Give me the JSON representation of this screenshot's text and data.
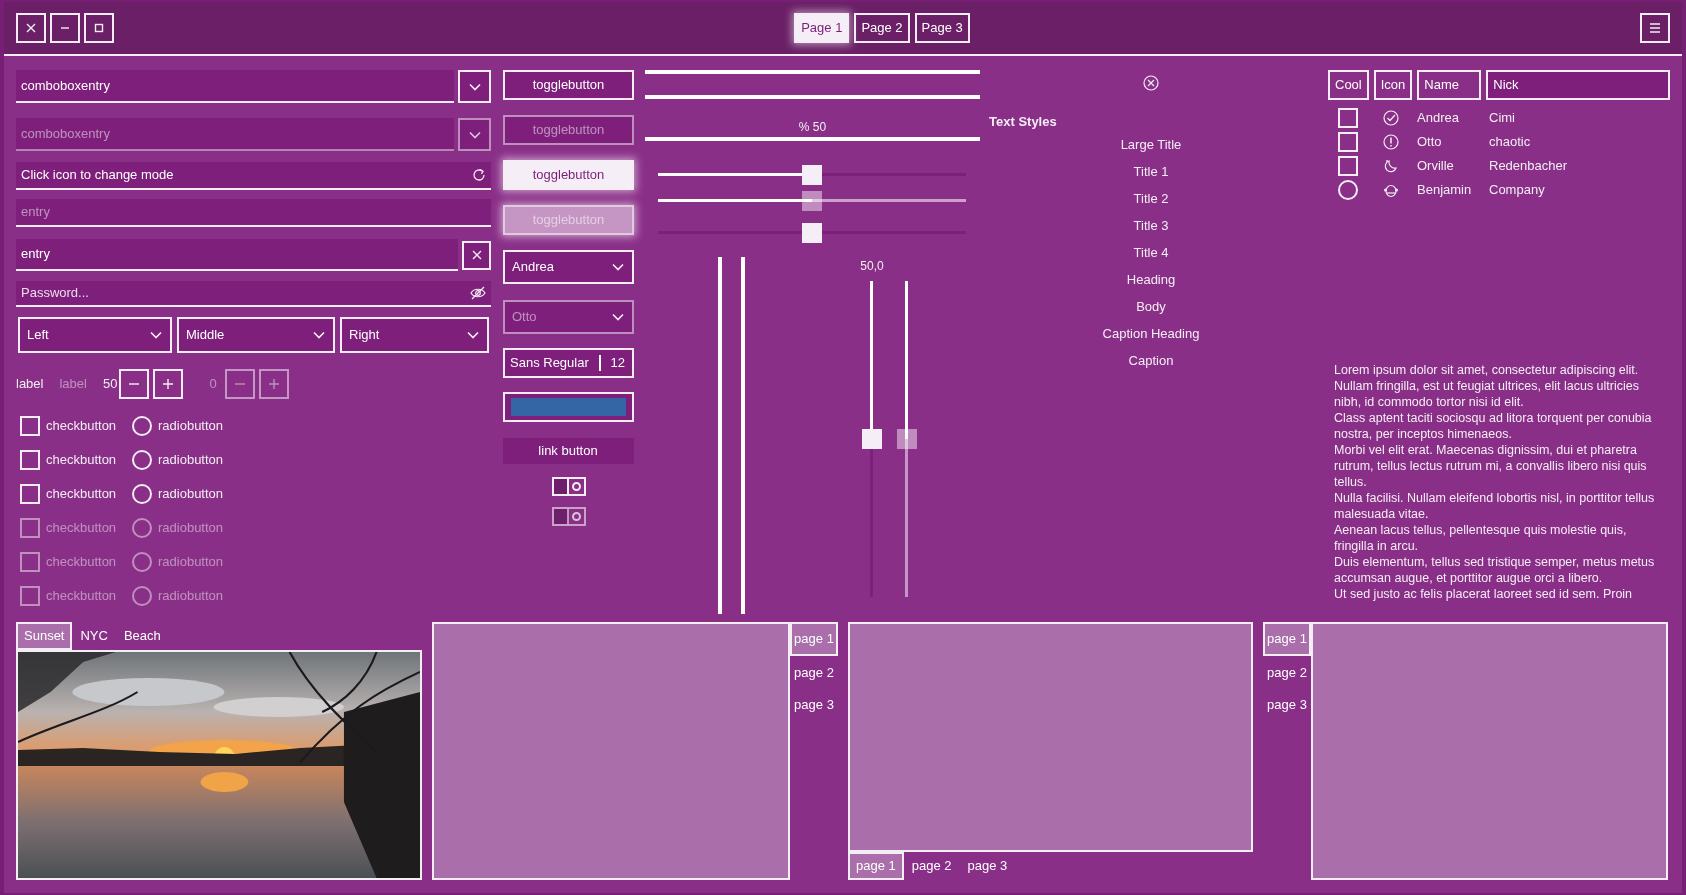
{
  "header": {
    "tabs": [
      {
        "label": "Page 1",
        "selected": true
      },
      {
        "label": "Page 2",
        "selected": false
      },
      {
        "label": "Page 3",
        "selected": false
      }
    ]
  },
  "entries": [
    {
      "kind": "combo",
      "value": "comboboxentry",
      "disabled": false
    },
    {
      "kind": "combo",
      "value": "comboboxentry",
      "disabled": true
    },
    {
      "kind": "icon",
      "value": "Click icon to change mode",
      "disabled": false
    },
    {
      "kind": "plain",
      "placeholder": "entry",
      "disabled": false
    },
    {
      "kind": "clear",
      "value": "entry",
      "disabled": false
    },
    {
      "kind": "password",
      "placeholder": "Password...",
      "disabled": false
    }
  ],
  "combos": [
    {
      "value": "Left"
    },
    {
      "value": "Middle"
    },
    {
      "value": "Right"
    }
  ],
  "labels": [
    {
      "text": "label",
      "disabled": false
    },
    {
      "text": "label",
      "disabled": true
    }
  ],
  "spins": [
    {
      "value": "50",
      "disabled": false
    },
    {
      "value": "0",
      "disabled": true
    }
  ],
  "checks": [
    {
      "label": "checkbutton",
      "checked": false,
      "disabled": false
    },
    {
      "label": "checkbutton",
      "checked": false,
      "disabled": false
    },
    {
      "label": "checkbutton",
      "checked": false,
      "disabled": false
    },
    {
      "label": "checkbutton",
      "checked": false,
      "disabled": true
    },
    {
      "label": "checkbutton",
      "checked": false,
      "disabled": true
    },
    {
      "label": "checkbutton",
      "checked": false,
      "disabled": true
    }
  ],
  "radios": [
    {
      "label": "radiobutton",
      "checked": false,
      "disabled": false
    },
    {
      "label": "radiobutton",
      "checked": false,
      "disabled": false
    },
    {
      "label": "radiobutton",
      "checked": false,
      "disabled": false
    },
    {
      "label": "radiobutton",
      "checked": false,
      "disabled": true
    },
    {
      "label": "radiobutton",
      "checked": false,
      "disabled": true
    },
    {
      "label": "radiobutton",
      "checked": false,
      "disabled": true
    }
  ],
  "toggle_buttons": [
    {
      "label": "togglebutton",
      "selected": false,
      "disabled": false
    },
    {
      "label": "togglebutton",
      "selected": false,
      "disabled": true
    },
    {
      "label": "togglebutton",
      "selected": true,
      "disabled": false
    },
    {
      "label": "togglebutton",
      "selected": true,
      "disabled": true
    }
  ],
  "dropdowns": [
    {
      "value": "Andrea",
      "disabled": false
    },
    {
      "value": "Otto",
      "disabled": true
    }
  ],
  "font_button": {
    "family": "Sans Regular",
    "size": "12"
  },
  "color_button": {
    "color": "#3465a4"
  },
  "link_button": {
    "label": "link button"
  },
  "switches": [
    {
      "on": false,
      "disabled": false
    },
    {
      "on": false,
      "disabled": true
    }
  ],
  "progress_bars": [
    {
      "level": 1
    },
    {
      "level": 1
    },
    {
      "level": 1,
      "text": "% 50"
    }
  ],
  "scales": [
    {
      "kind": "highlight",
      "level": 0.5,
      "disabled": false
    },
    {
      "kind": "highlight",
      "level": 0.5,
      "disabled": true
    },
    {
      "kind": "plain",
      "level": 0.5,
      "disabled": false
    }
  ],
  "vertical_bars": [
    {
      "level": 1
    },
    {
      "level": 1
    }
  ],
  "vscales": {
    "reading": "50,0",
    "items": [
      {
        "level": 0.5,
        "disabled": false
      },
      {
        "level": 0.5,
        "disabled": true
      }
    ]
  },
  "text_styles": {
    "title": "Text Styles",
    "items": [
      "Large Title",
      "Title 1",
      "Title 2",
      "Title 3",
      "Title 4",
      "Heading",
      "Body",
      "Caption Heading",
      "Caption"
    ]
  },
  "tree": {
    "columns": [
      "Cool",
      "Icon",
      "Name",
      "Nick"
    ],
    "rows": [
      {
        "kind": "check",
        "checked": false,
        "name": "Andrea",
        "nick": "Cimi"
      },
      {
        "kind": "check",
        "checked": false,
        "name": "Otto",
        "nick": "chaotic"
      },
      {
        "kind": "check",
        "checked": false,
        "name": "Orville",
        "nick": "Redenbacher"
      },
      {
        "kind": "radio",
        "checked": false,
        "name": "Benjamin",
        "nick": "Company"
      }
    ]
  },
  "lorem": [
    "Lorem ipsum dolor sit amet, consectetur adipiscing elit.",
    "Nullam fringilla, est ut feugiat ultrices, elit lacus ultricies nibh, id commodo tortor nisi id elit.",
    "Class aptent taciti sociosqu ad litora torquent per conubia nostra, per inceptos himenaeos.",
    "Morbi vel elit erat. Maecenas dignissim, dui et pharetra rutrum, tellus lectus rutrum mi, a convallis libero nisi quis tellus.",
    "Nulla facilisi. Nullam eleifend lobortis nisl, in porttitor tellus malesuada vitae.",
    "Aenean lacus tellus, pellentesque quis molestie quis, fringilla in arcu.",
    "Duis elementum, tellus sed tristique semper, metus metus accumsan augue, et porttitor augue orci a libero.",
    "Ut sed justo ac felis placerat laoreet sed id sem. Proin"
  ],
  "notebooks": [
    {
      "kind": "top",
      "tabs": [
        {
          "label": "Sunset",
          "selected": true
        },
        {
          "label": "NYC",
          "selected": false
        },
        {
          "label": "Beach",
          "selected": false
        }
      ]
    },
    {
      "kind": "right",
      "tabs": [
        {
          "label": "page 1",
          "selected": true
        },
        {
          "label": "page 2",
          "selected": false
        },
        {
          "label": "page 3",
          "selected": false
        }
      ]
    },
    {
      "kind": "bottom",
      "tabs": [
        {
          "label": "page 1",
          "selected": true
        },
        {
          "label": "page 2",
          "selected": false
        },
        {
          "label": "page 3",
          "selected": false
        }
      ]
    },
    {
      "kind": "left",
      "tabs": [
        {
          "label": "page 1",
          "selected": true
        },
        {
          "label": "page 2",
          "selected": false
        },
        {
          "label": "page 3",
          "selected": false
        }
      ]
    }
  ]
}
